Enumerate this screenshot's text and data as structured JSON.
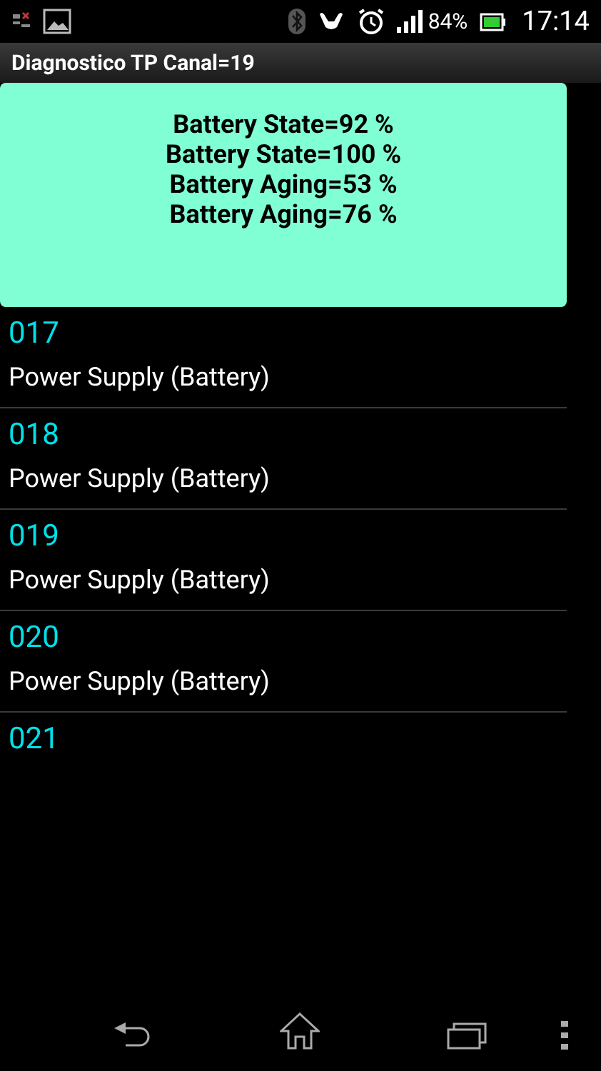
{
  "status_bar": {
    "battery": "84%",
    "time": "17:14"
  },
  "window": {
    "title": "Diagnostico TP Canal=19"
  },
  "toast": {
    "lines": [
      "Battery State=92 %",
      "Battery State=100 %",
      "Battery Aging=53 %",
      "Battery Aging=76 %"
    ]
  },
  "list": [
    {
      "code": "017",
      "label": "Power Supply (Battery)"
    },
    {
      "code": "018",
      "label": "Power Supply (Battery)"
    },
    {
      "code": "019",
      "label": "Power Supply (Battery)"
    },
    {
      "code": "020",
      "label": "Power Supply (Battery)"
    },
    {
      "code": "021"
    }
  ]
}
